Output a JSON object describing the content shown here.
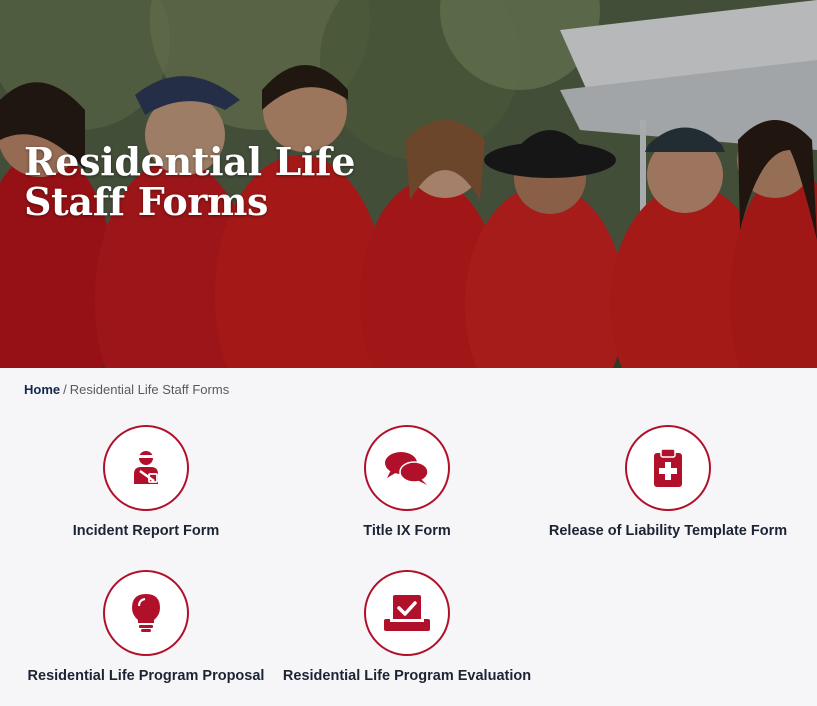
{
  "hero": {
    "title": "Residential Life\nStaff Forms"
  },
  "breadcrumb": {
    "home": "Home",
    "separator": "/",
    "current": "Residential Life Staff Forms"
  },
  "colors": {
    "accent": "#b1102b",
    "navy": "#13284c"
  },
  "forms": [
    {
      "label": "Incident Report Form",
      "icon": "injured-person-icon"
    },
    {
      "label": "Title IX Form",
      "icon": "chat-bubbles-icon"
    },
    {
      "label": "Release of Liability Template Form",
      "icon": "clipboard-medical-icon"
    },
    {
      "label": "Residential Life Program Proposal",
      "icon": "lightbulb-icon"
    },
    {
      "label": "Residential Life Program Evaluation",
      "icon": "ballot-box-check-icon"
    }
  ]
}
